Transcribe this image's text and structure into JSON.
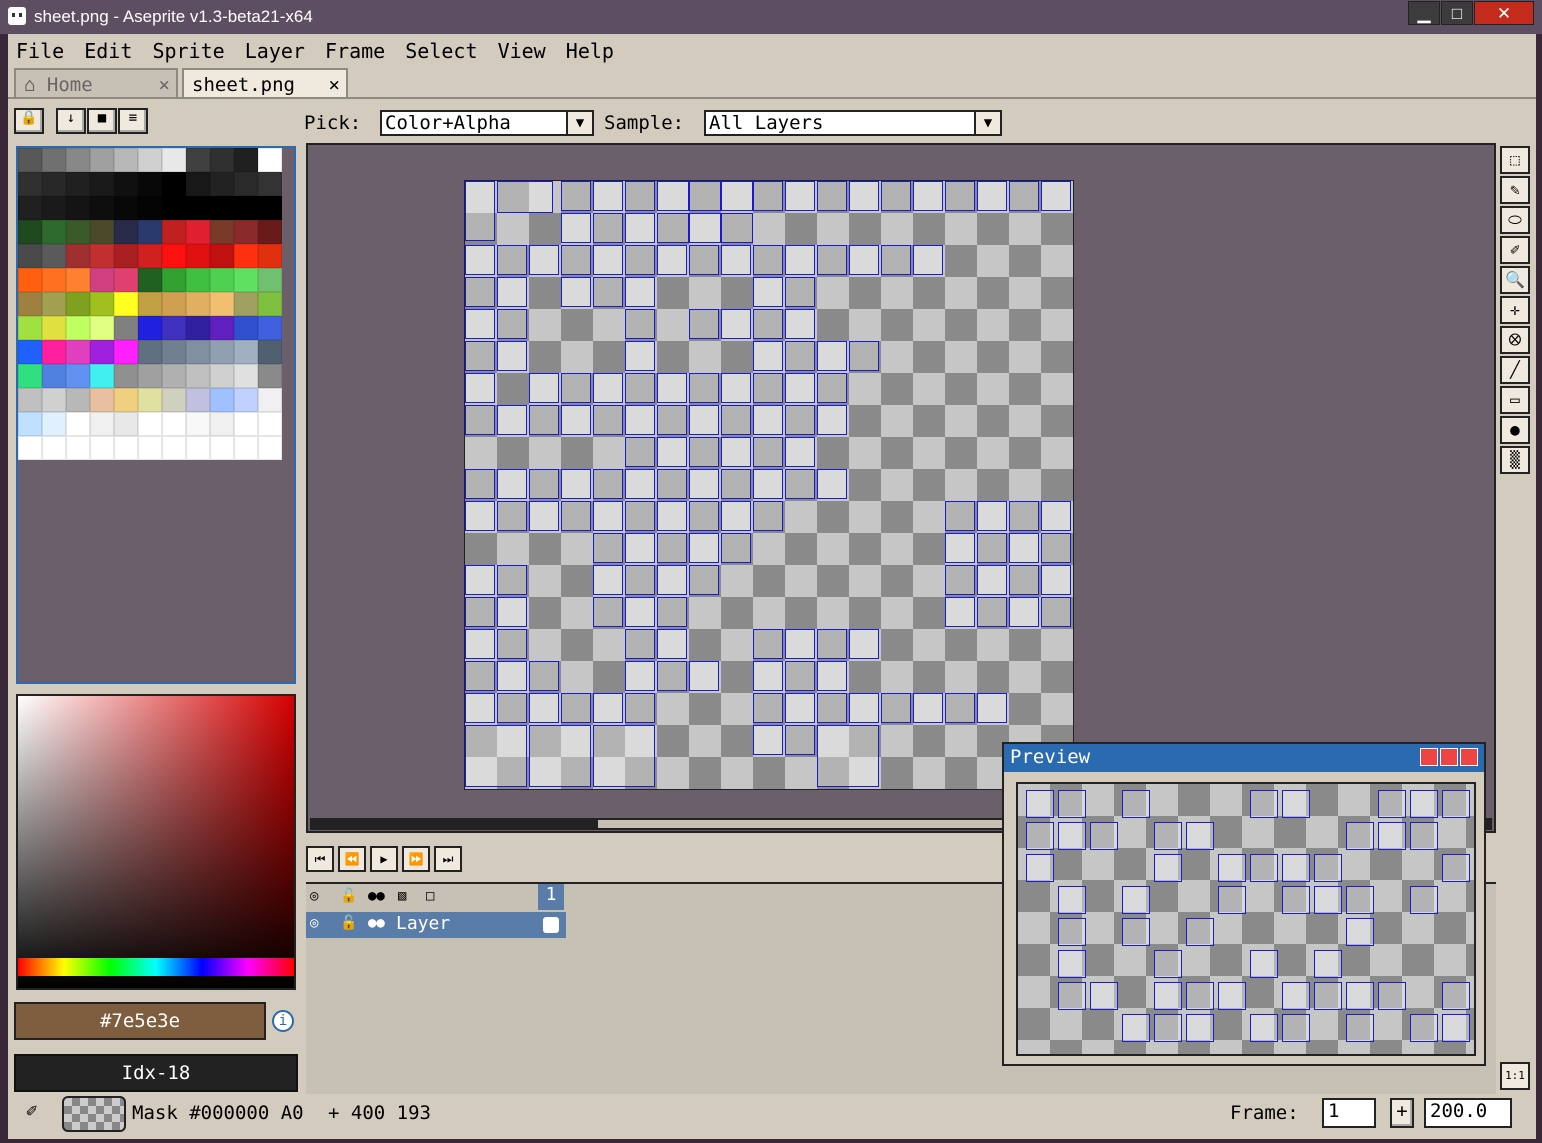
{
  "window": {
    "title": "sheet.png - Aseprite v1.3-beta21-x64",
    "minimize": "▁",
    "maximize": "□",
    "close": "✕"
  },
  "menu": [
    "File",
    "Edit",
    "Sprite",
    "Layer",
    "Frame",
    "Select",
    "View",
    "Help"
  ],
  "tabs": [
    {
      "label": "Home",
      "close": "×"
    },
    {
      "label": "sheet.png",
      "close": "×"
    }
  ],
  "toolbar": {
    "pick_label": "Pick:",
    "pick_value": "Color+Alpha",
    "sample_label": "Sample:",
    "sample_value": "All Layers"
  },
  "color": {
    "hex_label": "#7e5e3e",
    "hex_value": "#7e5e3e",
    "index_label": "Idx-18"
  },
  "palette": [
    "#585858",
    "#707070",
    "#888",
    "#a0a0a0",
    "#b8b8b8",
    "#d0d0d0",
    "#e8e8e8",
    "#404040",
    "#303030",
    "#202020",
    "#fff",
    "#303030",
    "#282828",
    "#202020",
    "#1a1a1a",
    "#101010",
    "#080808",
    "#000",
    "#181818",
    "#222",
    "#2a2a2a",
    "#333",
    "#202020",
    "#1a1a1a",
    "#141414",
    "#0e0e0e",
    "#080808",
    "#040404",
    "#000",
    "#000",
    "#000",
    "#000",
    "#000",
    "#1e4a1e",
    "#2e6a2e",
    "#3a5a2a",
    "#4a4a2a",
    "#2a2a4a",
    "#2a3a6a",
    "#c02020",
    "#e02030",
    "#7a3a2a",
    "#8a2a2a",
    "#6a1a1a",
    "#4a4a4a",
    "#5a5a5a",
    "#a03030",
    "#c03030",
    "#aa2020",
    "#d02020",
    "#ff1010",
    "#e01010",
    "#c01010",
    "#ff3010",
    "#e03010",
    "#ff6010",
    "#ff7020",
    "#ff8030",
    "#d04080",
    "#e04070",
    "#206020",
    "#30a030",
    "#40c040",
    "#50d050",
    "#60e060",
    "#70c070",
    "#a08040",
    "#a0a050",
    "#80a020",
    "#a0c020",
    "#ffff20",
    "#c0a040",
    "#d0a050",
    "#e0b060",
    "#f0c070",
    "#a0a060",
    "#80c040",
    "#a0e040",
    "#e0e040",
    "#c0ff60",
    "#e0ff80",
    "#808080",
    "#2020e0",
    "#4030c0",
    "#3020a0",
    "#6020c0",
    "#3050d0",
    "#4060e0",
    "#2060ff",
    "#ff20a0",
    "#e040c0",
    "#a020e0",
    "#ff20ff",
    "#607080",
    "#708090",
    "#8090a0",
    "#90a0b0",
    "#a0b0c0",
    "#506070",
    "#30e080",
    "#5080e0",
    "#6090f0",
    "#40f0f0",
    "#909090",
    "#a0a0a0",
    "#b0b0b0",
    "#c0c0c0",
    "#d0d0d0",
    "#e0e0e0",
    "#8a8a8a",
    "#c0c0c0",
    "#d0d0d0",
    "#b8b8b8",
    "#e8c0a0",
    "#f0d080",
    "#e0e0a0",
    "#d0d0c0",
    "#c0c0e0",
    "#a0c0ff",
    "#c0d0ff",
    "#f0f0f0",
    "#c0e0ff",
    "#e0f0ff",
    "#fff",
    "#f0f0f0",
    "#e8e8e8",
    "#fff",
    "#fff",
    "#f8f8f8",
    "#f0f0f0",
    "#fff",
    "#fff",
    "#fff",
    "#fff",
    "#fff",
    "#fff",
    "#fff",
    "#fff",
    "#fff",
    "#fff",
    "#fff",
    "#fff",
    "#fff"
  ],
  "playback": [
    "⏮",
    "⏪",
    "▶",
    "⏩",
    "⏭"
  ],
  "layers": {
    "frame_number": "1",
    "layer_name": "Layer"
  },
  "preview": {
    "title": "Preview"
  },
  "status": {
    "mask_text": "Mask #000000 A0",
    "coords": "+ 400 193",
    "frame_label": "Frame:",
    "frame_value": "1",
    "plus": "+",
    "zoom": "200.0"
  },
  "icons": [
    "lock-icon",
    "down-arrow-icon",
    "square-icon",
    "menu-icon",
    "marquee-icon",
    "pencil-icon",
    "eraser-icon",
    "eyedropper-icon",
    "zoom-icon",
    "move-icon",
    "bucket-icon",
    "line-icon",
    "rectangle-icon",
    "blob-icon",
    "spray-icon"
  ],
  "tool_glyphs": [
    "⬚",
    "✎",
    "⬭",
    "✐",
    "🔍",
    "✛",
    "⭙",
    "╱",
    "▭",
    "●",
    "▒"
  ],
  "corner_glyph": "1:1"
}
